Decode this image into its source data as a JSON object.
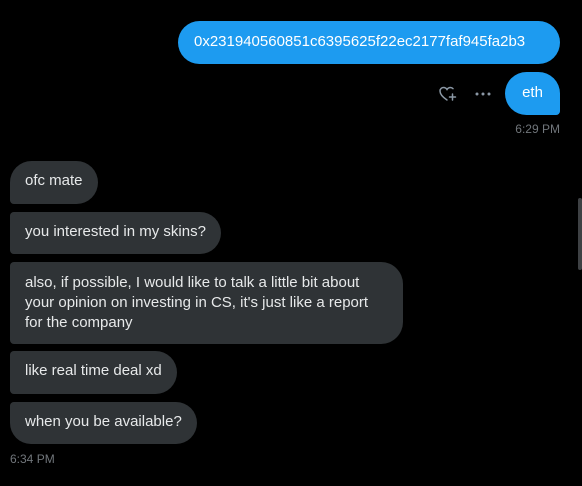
{
  "outgoing": [
    {
      "text": "0x231940560851c6395625f22ec2177faf945fa2b3"
    },
    {
      "text": "eth"
    }
  ],
  "outgoing_timestamp": "6:29 PM",
  "incoming": [
    {
      "text": "ofc mate"
    },
    {
      "text": "you interested in my skins?"
    },
    {
      "lines": [
        "also, if possible, I would like to talk a little bit about",
        "your opinion on investing in CS, it's just like a report",
        "for the company"
      ]
    },
    {
      "text": "like real time deal xd"
    },
    {
      "text": "when you be available?"
    }
  ],
  "incoming_timestamp": "6:34 PM",
  "icons": {
    "react": "heart-plus-icon",
    "more": "more-dots-icon"
  }
}
